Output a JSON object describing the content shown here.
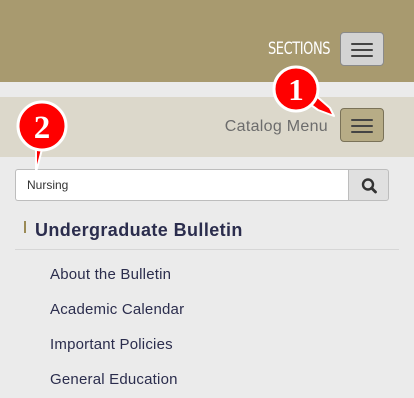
{
  "header": {
    "sections_label": "SECTIONS",
    "sections_button_icon": "hamburger-menu-icon"
  },
  "catalog": {
    "menu_label": "Catalog Menu",
    "menu_button_icon": "hamburger-menu-icon"
  },
  "search": {
    "value": "Nursing",
    "button_icon": "search-icon"
  },
  "nav": {
    "heading": "Undergraduate Bulletin",
    "items": [
      {
        "label": "About the Bulletin"
      },
      {
        "label": "Academic Calendar"
      },
      {
        "label": "Important Policies"
      },
      {
        "label": "General Education"
      }
    ]
  },
  "annotations": {
    "marker_1": "1",
    "marker_2": "2"
  },
  "colors": {
    "header_gold": "#a89a6f",
    "catalog_strip": "#dcd8cb",
    "catalog_button": "#b7ac86",
    "heading_navy": "#2b2d4d",
    "callout_red": "#ff0000"
  }
}
